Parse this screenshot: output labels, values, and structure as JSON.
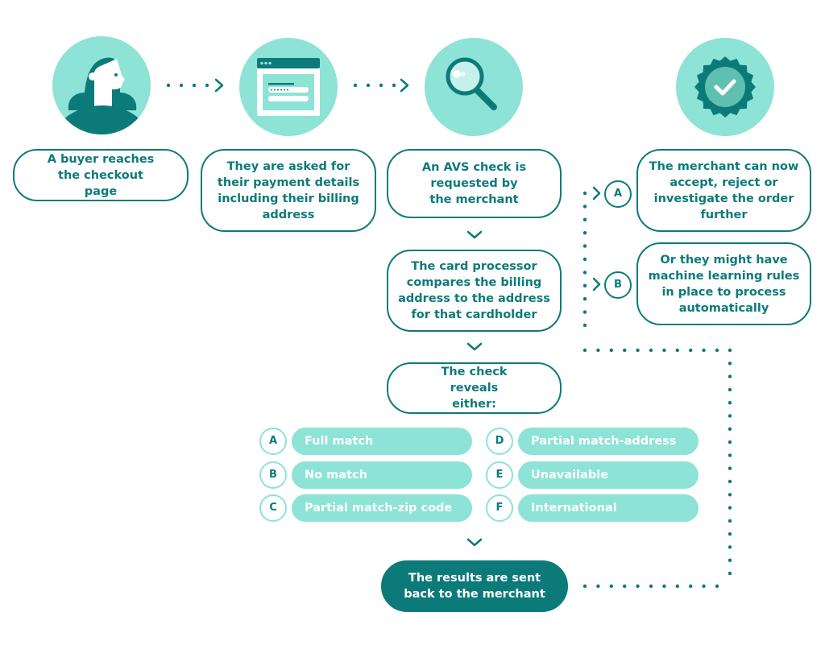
{
  "colors": {
    "teal_dark": "#0d7a7a",
    "teal_light": "#8de3d6",
    "white": "#ffffff"
  },
  "steps": {
    "buyer": {
      "icon": "person-icon",
      "text": "A buyer reaches the checkout page"
    },
    "payment": {
      "icon": "browser-form-icon",
      "text": "They are asked for their payment details including their billing address"
    },
    "avs": {
      "icon": "magnifier-icon",
      "text": "An AVS check is requested by the merchant"
    },
    "compare": {
      "text": "The card processor compares the billing address to the address for that cardholder"
    },
    "reveal": {
      "text": "The check reveals either:"
    },
    "results": {
      "text": "The results are sent back to the merchant"
    }
  },
  "outcomes": [
    {
      "letter": "A",
      "label": "Full match"
    },
    {
      "letter": "B",
      "label": "No match"
    },
    {
      "letter": "C",
      "label": "Partial match-zip code"
    },
    {
      "letter": "D",
      "label": "Partial match-address"
    },
    {
      "letter": "E",
      "label": "Unavailable"
    },
    {
      "letter": "F",
      "label": "International"
    }
  ],
  "merchant_options": {
    "icon": "verified-badge-icon",
    "a": {
      "letter": "A",
      "text": "The merchant can now accept, reject or investigate the order further"
    },
    "b": {
      "letter": "B",
      "text": "Or they might have machine learning rules in place to process automatically"
    }
  }
}
